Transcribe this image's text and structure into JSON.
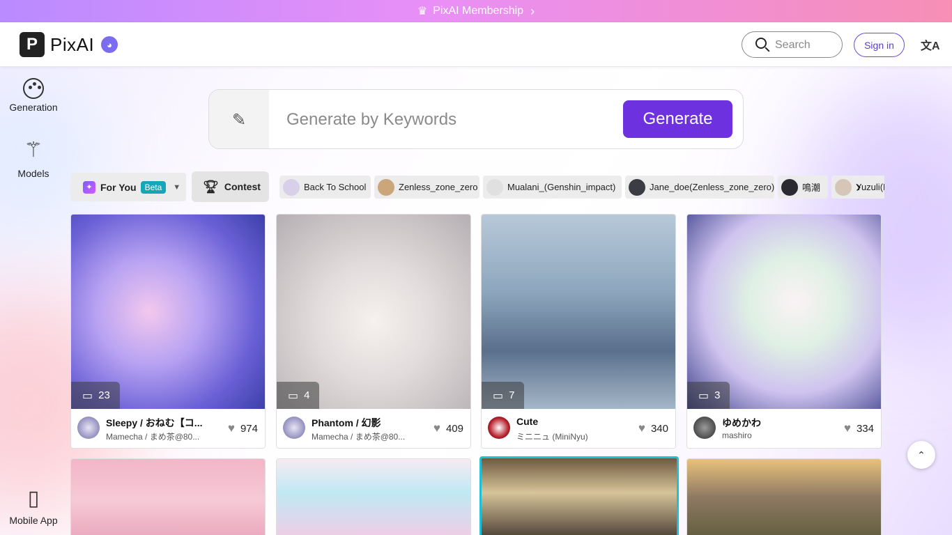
{
  "banner": {
    "label": "PixAI Membership"
  },
  "header": {
    "logo_letter": "P",
    "logo_text": "PixAI",
    "search_placeholder": "Search",
    "signin_label": "Sign in",
    "translate_icon": "文A"
  },
  "sidebar": {
    "items": [
      {
        "label": "Generation",
        "icon": "palette-icon"
      },
      {
        "label": "Models",
        "icon": "magic-wand-icon"
      },
      {
        "label": "Mobile App",
        "icon": "phone-download-icon"
      }
    ]
  },
  "prompt": {
    "placeholder": "Generate by Keywords",
    "generate_label": "Generate"
  },
  "filters": {
    "foryou_label": "For You",
    "beta_label": "Beta",
    "contest_label": "Contest",
    "tags": [
      {
        "label": "Back To School",
        "color": "#d8d0e8"
      },
      {
        "label": "Zenless_zone_zero",
        "color": "#caa67a"
      },
      {
        "label": "Mualani_(Genshin_impact)",
        "color": "#e0e0e0"
      },
      {
        "label": "Jane_doe(Zenless_zone_zero)",
        "color": "#3c3c44"
      },
      {
        "label": "鳴潮",
        "color": "#2a2a30"
      },
      {
        "label": "Yuzuli(H",
        "color": "#d6c6b8"
      }
    ]
  },
  "cards": [
    {
      "comments": "23",
      "title": "Sleepy / おねむ【コ...",
      "author": "Mamecha / まめ茶@80...",
      "likes": "974"
    },
    {
      "comments": "4",
      "title": "Phantom / 幻影",
      "author": "Mamecha / まめ茶@80...",
      "likes": "409"
    },
    {
      "comments": "7",
      "title": "Cute",
      "author": "ミニニュ (MiniNyu)",
      "likes": "340"
    },
    {
      "comments": "3",
      "title": "ゆめかわ",
      "author": "mashiro",
      "likes": "334"
    }
  ],
  "colors": {
    "accent": "#6e31e0",
    "beta": "#16a6b8",
    "selected_border": "#1ec0d6"
  }
}
